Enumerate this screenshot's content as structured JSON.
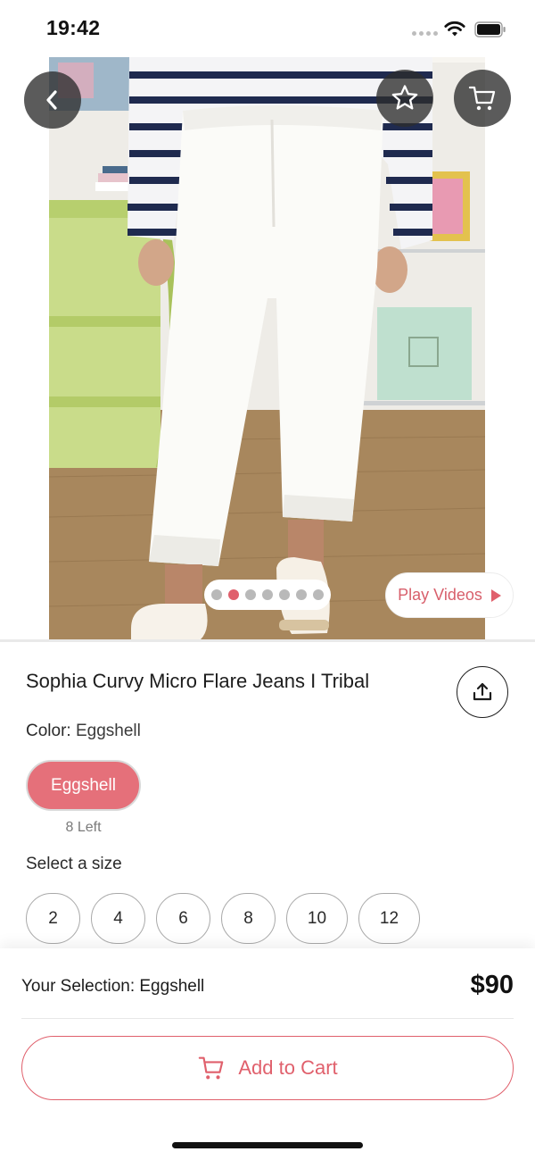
{
  "status_bar": {
    "time": "19:42"
  },
  "hero": {
    "image_alt": "Model wearing white cropped flare jeans with a striped sweater and white sneakers",
    "pager": {
      "total": 7,
      "active_index": 1
    },
    "play_videos_label": "Play Videos"
  },
  "product": {
    "title": "Sophia Curvy Micro Flare Jeans I Tribal",
    "color_label": "Color:",
    "color_value": "Eggshell",
    "swatch_label": "Eggshell",
    "stock_text": "8 Left",
    "size_label": "Select a size",
    "sizes": [
      "2",
      "4",
      "6",
      "8",
      "10",
      "12"
    ]
  },
  "bottom_bar": {
    "selection_text": "Your Selection: Eggshell",
    "price": "$90",
    "add_to_cart_label": "Add to Cart"
  },
  "colors": {
    "accent": "#e0606c",
    "swatch": "#e5707a"
  },
  "icons": [
    "back-arrow-icon",
    "star-icon",
    "cart-icon",
    "share-icon",
    "play-icon",
    "wifi-icon",
    "battery-icon"
  ]
}
